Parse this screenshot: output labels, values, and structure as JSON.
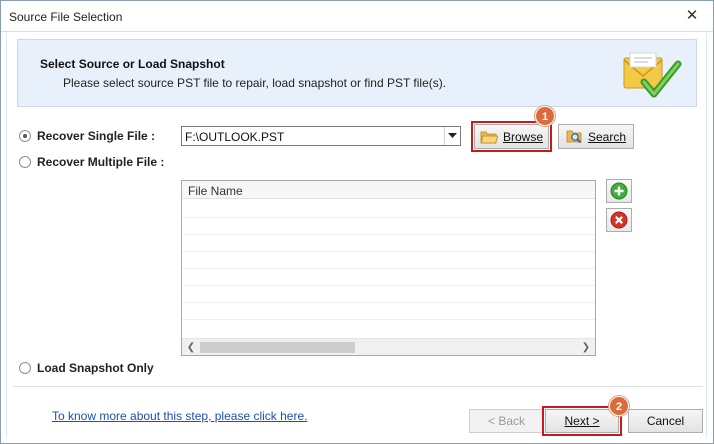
{
  "window": {
    "title": "Source File Selection",
    "close_glyph": "✕"
  },
  "banner": {
    "heading": "Select Source or Load Snapshot",
    "subtitle": "Please select source PST file to repair, load snapshot or find PST file(s)."
  },
  "options": {
    "single_label": "Recover Single File :",
    "multiple_label": "Recover Multiple File :",
    "snapshot_label": "Load Snapshot Only",
    "selected": "single"
  },
  "path_combo": {
    "value": "F:\\OUTLOOK.PST"
  },
  "buttons": {
    "browse": "Browse",
    "search": "Search",
    "back": "< Back",
    "next": "Next >",
    "cancel": "Cancel"
  },
  "callouts": {
    "browse_step": "1",
    "next_step": "2",
    "color": "#dc6a3c",
    "highlight_color": "#c8191b"
  },
  "file_grid": {
    "column_header": "File Name",
    "rows": []
  },
  "side_icons": {
    "add": "plus-circle-icon",
    "remove": "x-circle-icon"
  },
  "help_link": "To know more about this step, please click here."
}
